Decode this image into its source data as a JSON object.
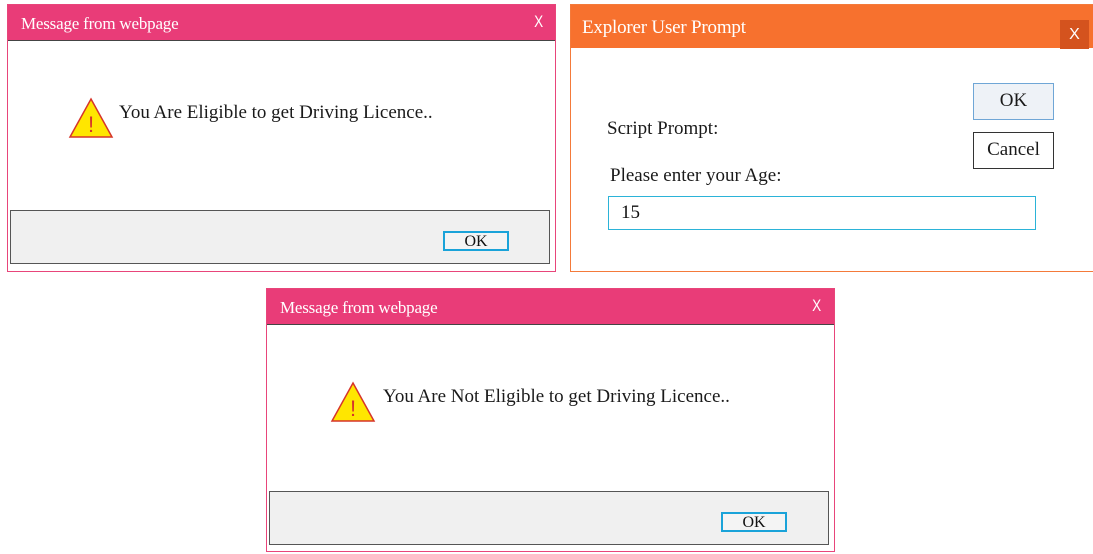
{
  "colors": {
    "alert_titlebar": "#e93c78",
    "alert_border": "#e8457a",
    "prompt_titlebar": "#f7712e",
    "prompt_close_bg": "#d4531e",
    "ok_button_border": "#1aa3d9",
    "warning_fill": "#ffe600",
    "warning_stroke": "#d6342a"
  },
  "eligible_dialog": {
    "title": "Message from webpage",
    "close_label": "X",
    "icon": "warning-icon",
    "warning_glyph": "!",
    "message": "You Are Eligible to get Driving Licence..",
    "ok_label": "OK"
  },
  "prompt_dialog": {
    "title": "Explorer User Prompt",
    "close_label": "X",
    "script_prompt_label": "Script Prompt:",
    "question": "Please enter your Age:",
    "input_value": "15",
    "ok_label": "OK",
    "cancel_label": "Cancel"
  },
  "not_eligible_dialog": {
    "title": "Message from webpage",
    "close_label": "X",
    "icon": "warning-icon",
    "warning_glyph": "!",
    "message": "You Are Not Eligible to get Driving Licence..",
    "ok_label": "OK"
  }
}
